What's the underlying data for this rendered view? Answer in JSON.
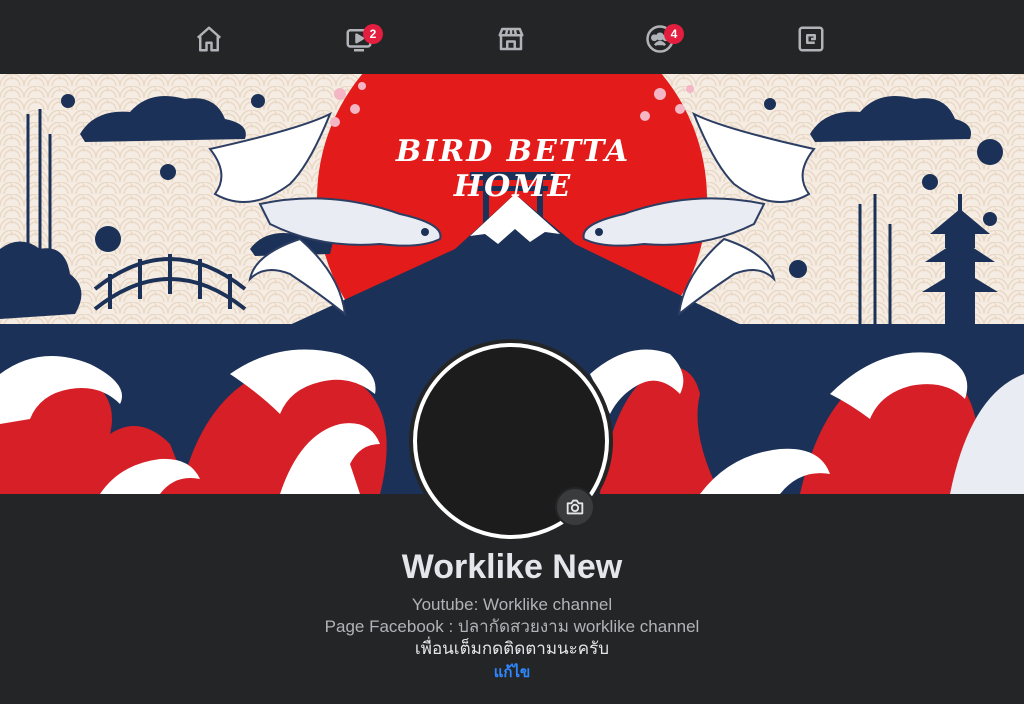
{
  "nav": {
    "items": [
      {
        "name": "home",
        "icon": "home-icon",
        "badge": null
      },
      {
        "name": "watch",
        "icon": "video-icon",
        "badge": "2"
      },
      {
        "name": "marketplace",
        "icon": "store-icon",
        "badge": null
      },
      {
        "name": "groups",
        "icon": "groups-icon",
        "badge": "4"
      },
      {
        "name": "gaming",
        "icon": "gaming-icon",
        "badge": null
      }
    ]
  },
  "cover": {
    "title": "BIRD BETTA HOME",
    "colors": {
      "sun": "#e31b1b",
      "navy": "#1c3157",
      "cream": "#f5ede3"
    }
  },
  "profile": {
    "name": "Worklike New",
    "bio": [
      "Youtube: Worklike channel",
      "Page Facebook : ปลากัดสวยงาม worklike channel",
      "เพื่อนเต็มกดติดตามนะครับ"
    ],
    "edit_label": "แก้ไข"
  },
  "colors": {
    "accent": "#2d88ff",
    "badge": "#e41e3f",
    "background": "#242526"
  }
}
